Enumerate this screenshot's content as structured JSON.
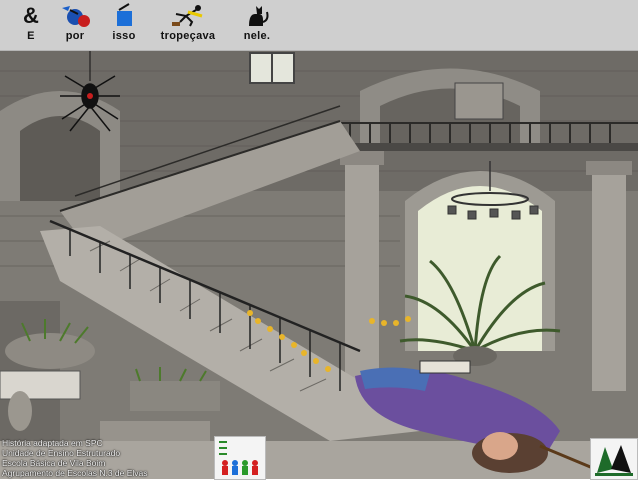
{
  "sentence": [
    {
      "label": "E",
      "icon": "ampersand-icon",
      "glyph": "&"
    },
    {
      "label": "por",
      "icon": "bomb-icon"
    },
    {
      "label": "isso",
      "icon": "cup-icon"
    },
    {
      "label": "tropeçava",
      "icon": "tripping-person-icon"
    },
    {
      "label": "nele.",
      "icon": "cat-icon"
    }
  ],
  "credits": [
    "História adaptada em SPC",
    "Unidade de Ensino Estruturado",
    "Escola Básica de Vila Boim",
    "Agrupamento  de Escolas N.3 de Elvas"
  ],
  "colors": {
    "toolbar_bg": "#cfcfcf",
    "stone": "#8a8a86",
    "wall_dark": "#5c5a56",
    "robe": "#6b4f9e",
    "window": "#e8ecd6"
  }
}
